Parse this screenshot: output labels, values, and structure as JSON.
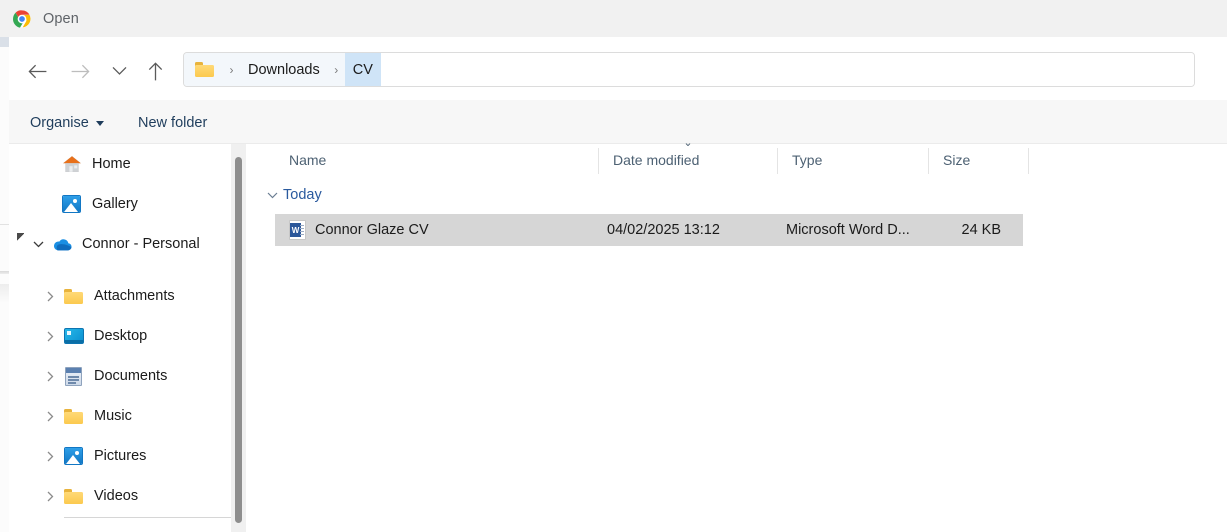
{
  "window": {
    "app_icon": "chrome-logo-icon",
    "title": "Open"
  },
  "navigation": {
    "back": {
      "icon": "back-arrow-icon",
      "label": "Back",
      "enabled": true
    },
    "forward": {
      "icon": "forward-arrow-icon",
      "label": "Forward",
      "enabled": false
    },
    "recent": {
      "icon": "chevron-down-icon",
      "label": "Recent locations"
    },
    "up": {
      "icon": "up-arrow-icon",
      "label": "Up to Downloads"
    }
  },
  "address_bar": {
    "folder_icon": "folder-icon",
    "separator": "›",
    "crumbs": [
      {
        "label": "Downloads",
        "selected": false
      },
      {
        "label": "CV",
        "selected": true
      }
    ]
  },
  "command_bar": {
    "organise_label": "Organise",
    "organise_has_caret": true,
    "new_folder_label": "New folder"
  },
  "sidebar": {
    "items": [
      {
        "label": "Home",
        "icon": "home-icon",
        "chevron": "",
        "indent": 0
      },
      {
        "label": "Gallery",
        "icon": "gallery-icon",
        "chevron": "",
        "indent": 0
      },
      {
        "label": "Connor - Personal",
        "icon": "onedrive-icon",
        "chevron": "⌄",
        "indent": 0,
        "expanded": true
      },
      {
        "label": "Attachments",
        "icon": "folder-icon",
        "chevron": "›",
        "indent": 1
      },
      {
        "label": "Desktop",
        "icon": "desktop-icon",
        "chevron": "›",
        "indent": 1
      },
      {
        "label": "Documents",
        "icon": "documents-icon",
        "chevron": "›",
        "indent": 1
      },
      {
        "label": "Music",
        "icon": "folder-icon",
        "chevron": "›",
        "indent": 1
      },
      {
        "label": "Pictures",
        "icon": "pictures-icon",
        "chevron": "›",
        "indent": 1
      },
      {
        "label": "Videos",
        "icon": "folder-icon",
        "chevron": "›",
        "indent": 1
      }
    ]
  },
  "file_list": {
    "columns": [
      {
        "key": "name",
        "label": "Name",
        "sorted": false
      },
      {
        "key": "date",
        "label": "Date modified",
        "sorted": true,
        "sort_direction": "descending",
        "sort_glyph": "⌄"
      },
      {
        "key": "type",
        "label": "Type",
        "sorted": false
      },
      {
        "key": "size",
        "label": "Size",
        "sorted": false
      }
    ],
    "groups": [
      {
        "label": "Today",
        "expanded": true,
        "chevron": "⌄",
        "rows": [
          {
            "name": "Connor Glaze CV",
            "date": "04/02/2025 13:12",
            "type": "Microsoft Word D...",
            "size": "24 KB",
            "icon": "word-document-icon",
            "icon_letter": "W",
            "selected": true
          }
        ]
      }
    ]
  },
  "colors": {
    "titlebar_bg": "#f1f1f1",
    "command_bar_bg": "#f7f7f7",
    "selection_bg": "#d6d6d6",
    "crumb_bg": "#f3f7fb",
    "crumb_selected_bg": "#cfe4f7",
    "group_label": "#2a5a9e",
    "column_header_text": "#4d6173",
    "accent": "#2a5a9e"
  }
}
